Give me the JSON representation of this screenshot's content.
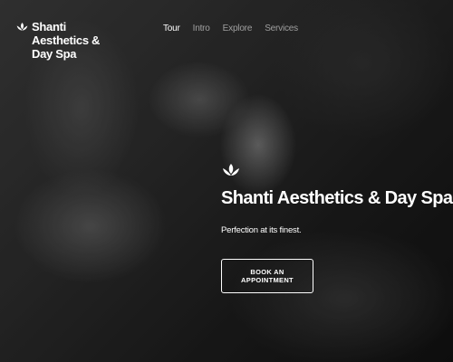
{
  "brand": {
    "name": "Shanti Aesthetics & Day Spa",
    "logo_icon": "lotus-icon",
    "logo_color": "#ffffff"
  },
  "nav": {
    "items": [
      {
        "label": "Tour",
        "active": true
      },
      {
        "label": "Intro",
        "active": false
      },
      {
        "label": "Explore",
        "active": false
      },
      {
        "label": "Services",
        "active": false
      }
    ]
  },
  "hero": {
    "logo_icon": "lotus-icon",
    "title": "Shanti Aesthetics & Day Spa",
    "tagline": "Perfection at its finest.",
    "cta_label": "BOOK AN APPOINTMENT",
    "background_image": "grayscale massage photo"
  }
}
